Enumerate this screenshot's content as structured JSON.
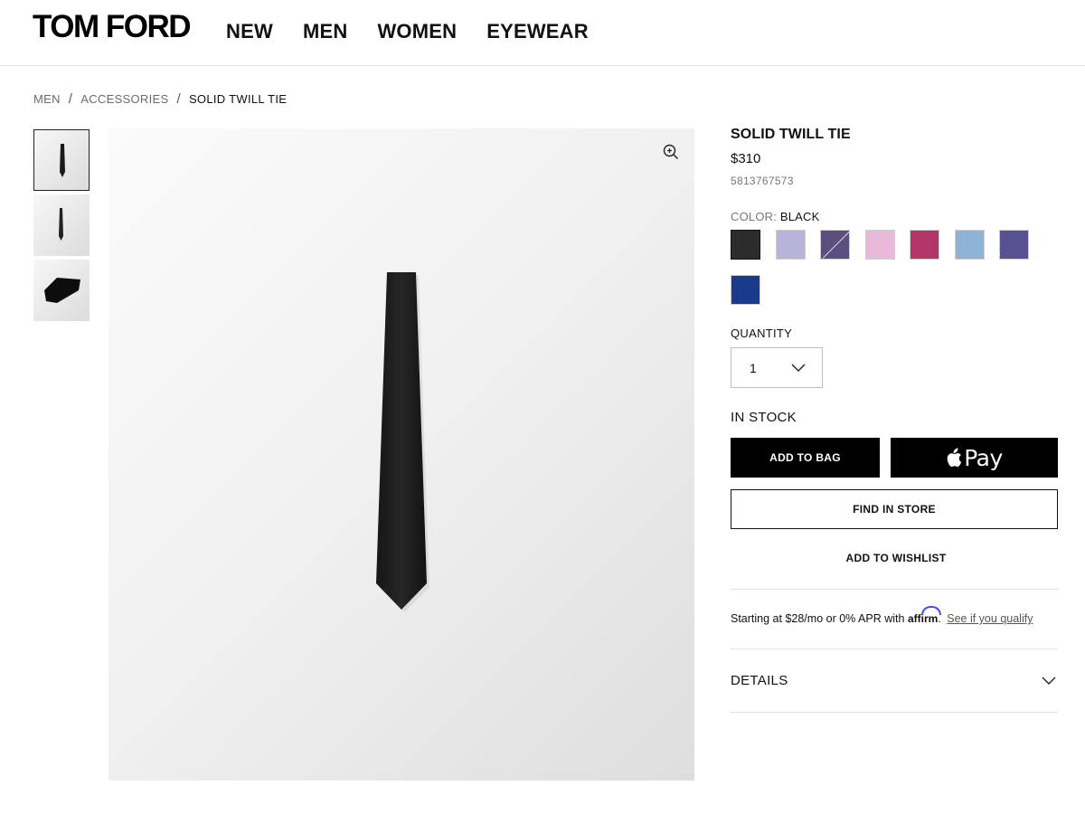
{
  "header": {
    "logo": "TOM FORD",
    "nav": [
      "NEW",
      "MEN",
      "WOMEN",
      "EYEWEAR"
    ]
  },
  "breadcrumb": {
    "items": [
      "MEN",
      "ACCESSORIES"
    ],
    "current": "SOLID TWILL TIE",
    "separator": "/"
  },
  "product": {
    "title": "SOLID TWILL TIE",
    "price": "$310",
    "sku": "5813767573",
    "color_label": "COLOR:",
    "color_value": "BLACK",
    "swatches": [
      {
        "color": "#2c2c2c",
        "selected": true,
        "icon": "none"
      },
      {
        "color": "#b7b3d9",
        "selected": false,
        "icon": "none"
      },
      {
        "color": "#5a4f7e",
        "selected": false,
        "icon": "slash"
      },
      {
        "color": "#e8b9da",
        "selected": false,
        "icon": "none"
      },
      {
        "color": "#b23568",
        "selected": false,
        "icon": "none"
      },
      {
        "color": "#8eb3d6",
        "selected": false,
        "icon": "none"
      },
      {
        "color": "#565190",
        "selected": false,
        "icon": "none"
      },
      {
        "color": "#1a3a8d",
        "selected": false,
        "icon": "none"
      }
    ],
    "quantity_label": "QUANTITY",
    "quantity_value": "1",
    "stock_status": "IN STOCK",
    "add_to_bag": "ADD TO BAG",
    "apple_pay": "Pay",
    "find_in_store": "FIND IN STORE",
    "add_to_wishlist": "ADD TO WISHLIST",
    "affirm_text": "Starting at $28/mo or 0% APR with",
    "affirm_logo": "affirm",
    "affirm_link": "See if you qualify",
    "details_label": "DETAILS"
  },
  "gallery": {
    "thumbnails": [
      "tie-front-thumb",
      "tie-back-thumb",
      "tie-folded-thumb"
    ],
    "active_index": 0
  },
  "colors": {
    "button_bg": "#000000",
    "affirm_accent": "#4a4af4"
  }
}
